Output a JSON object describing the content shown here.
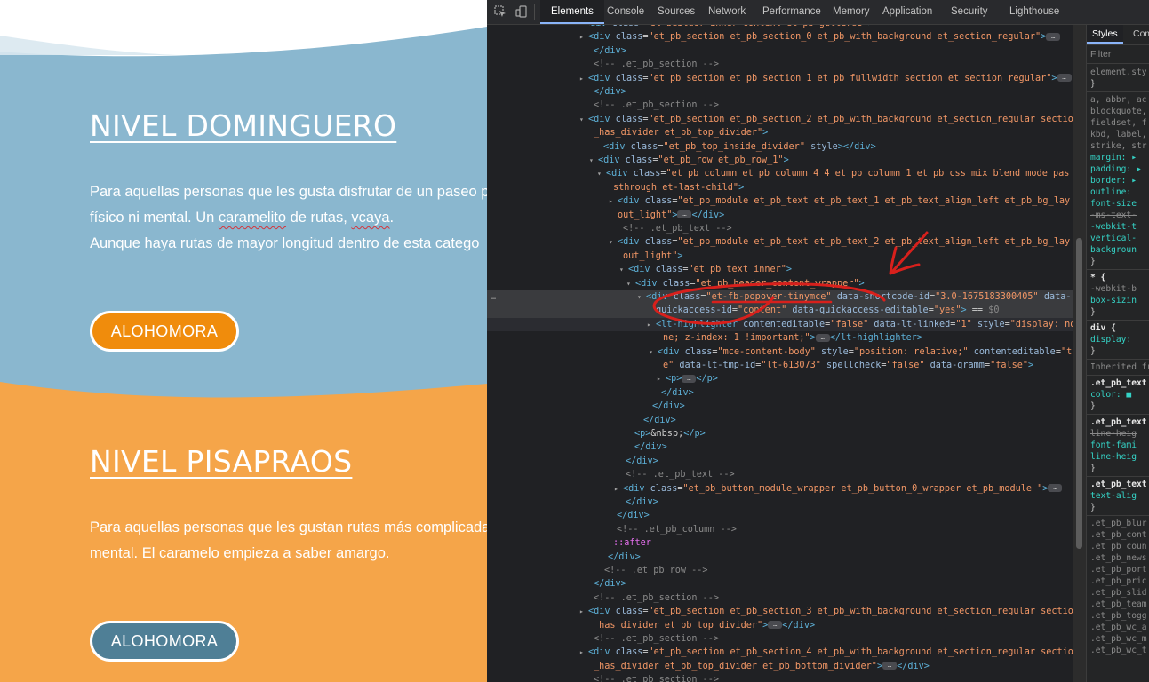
{
  "website": {
    "section1": {
      "title": "NIVEL DOMINGUERO",
      "para_line1": "Para aquellas personas que les gusta disfrutar de un paseo p",
      "para_line2_a": "físico ni mental. Un ",
      "para_line2_b": "caramelito",
      "para_line2_c": " de rutas, ",
      "para_line2_d": "vcaya",
      "para_line2_e": ".",
      "para_line3": "Aunque haya rutas de mayor longitud dentro de esta catego",
      "button": "ALOHOMORA",
      "bg_color": "#8ab7cf",
      "button_color": "#f08c0c"
    },
    "section2": {
      "title": "NIVEL PISAPRAOS",
      "para_line1": "Para aquellas personas que les gustan rutas más complicada",
      "para_line2": "mental. El caramelo empieza a saber amargo.",
      "button": "ALOHOMORA",
      "bg_color": "#f5a549",
      "button_color": "#4f7f96"
    }
  },
  "devtools": {
    "tabs": [
      "Elements",
      "Console",
      "Sources",
      "Network",
      "Performance",
      "Memory",
      "Application",
      "Security",
      "Lighthouse"
    ],
    "active_tab": "Elements",
    "dom_lines": [
      [
        [
          "tg",
          "<div "
        ],
        [
          "an",
          "class"
        ],
        [
          "tx",
          "="
        ],
        [
          "av",
          "\"et_builder_inner_content et_pb_gutters3\""
        ],
        [
          "tg",
          ">"
        ]
      ],
      [
        [
          "tg",
          "<div "
        ],
        [
          "an",
          "class"
        ],
        [
          "tx",
          "="
        ],
        [
          "av",
          "\"et_pb_section et_pb_section_0 et_pb_with_background et_section_regular\""
        ],
        [
          "tg",
          ">"
        ],
        [
          "el",
          "…"
        ]
      ],
      [
        [
          "tg",
          "</div>"
        ]
      ],
      [
        [
          "cm",
          "<!-- .et_pb_section -->"
        ]
      ],
      [
        [
          "tg",
          "<div "
        ],
        [
          "an",
          "class"
        ],
        [
          "tx",
          "="
        ],
        [
          "av",
          "\"et_pb_section et_pb_section_1 et_pb_fullwidth_section et_section_regular\""
        ],
        [
          "tg",
          ">"
        ],
        [
          "el",
          "…"
        ]
      ],
      [
        [
          "tg",
          "</div>"
        ]
      ],
      [
        [
          "cm",
          "<!-- .et_pb_section -->"
        ]
      ],
      [
        [
          "tg",
          "<div "
        ],
        [
          "an",
          "class"
        ],
        [
          "tx",
          "="
        ],
        [
          "av",
          "\"et_pb_section et_pb_section_2 et_pb_with_background et_section_regular section"
        ]
      ],
      [
        [
          "av",
          "_has_divider et_pb_top_divider\""
        ],
        [
          "tg",
          ">"
        ]
      ],
      [
        [
          "tg",
          "<div "
        ],
        [
          "an",
          "class"
        ],
        [
          "tx",
          "="
        ],
        [
          "av",
          "\"et_pb_top_inside_divider\""
        ],
        [
          "tx",
          " "
        ],
        [
          "an",
          "style"
        ],
        [
          "tg",
          "></div>"
        ]
      ],
      [
        [
          "tg",
          "<div "
        ],
        [
          "an",
          "class"
        ],
        [
          "tx",
          "="
        ],
        [
          "av",
          "\"et_pb_row et_pb_row_1\""
        ],
        [
          "tg",
          ">"
        ]
      ],
      [
        [
          "tg",
          "<div "
        ],
        [
          "an",
          "class"
        ],
        [
          "tx",
          "="
        ],
        [
          "av",
          "\"et_pb_column et_pb_column_4_4 et_pb_column_1  et_pb_css_mix_blend_mode_pas"
        ]
      ],
      [
        [
          "av",
          "sthrough et-last-child\""
        ],
        [
          "tg",
          ">"
        ]
      ],
      [
        [
          "tg",
          "<div "
        ],
        [
          "an",
          "class"
        ],
        [
          "tx",
          "="
        ],
        [
          "av",
          "\"et_pb_module et_pb_text et_pb_text_1  et_pb_text_align_left et_pb_bg_lay"
        ]
      ],
      [
        [
          "av",
          "out_light\""
        ],
        [
          "tg",
          ">"
        ],
        [
          "el",
          "…"
        ],
        [
          "tg",
          "</div>"
        ]
      ],
      [
        [
          "cm",
          "<!-- .et_pb_text -->"
        ]
      ],
      [
        [
          "tg",
          "<div "
        ],
        [
          "an",
          "class"
        ],
        [
          "tx",
          "="
        ],
        [
          "av",
          "\"et_pb_module et_pb_text et_pb_text_2  et_pb_text_align_left et_pb_bg_lay"
        ]
      ],
      [
        [
          "av",
          "out_light\""
        ],
        [
          "tg",
          ">"
        ]
      ],
      [
        [
          "tg",
          "<div "
        ],
        [
          "an",
          "class"
        ],
        [
          "tx",
          "="
        ],
        [
          "av",
          "\"et_pb_text_inner\""
        ],
        [
          "tg",
          ">"
        ]
      ],
      [
        [
          "tg",
          "<div "
        ],
        [
          "an",
          "class"
        ],
        [
          "tx",
          "="
        ],
        [
          "av",
          "\"et_pb_header_content_wrapper\""
        ],
        [
          "tg",
          ">"
        ]
      ],
      [
        [
          "tg",
          "<div "
        ],
        [
          "an",
          "class"
        ],
        [
          "tx",
          "="
        ],
        [
          "av",
          "\"et-fb-popover-tinymce\""
        ],
        [
          "tx",
          " "
        ],
        [
          "an",
          "data-shortcode-id"
        ],
        [
          "tx",
          "="
        ],
        [
          "av",
          "\"3.0-1675183300405\""
        ],
        [
          "tx",
          " "
        ],
        [
          "an",
          "data-"
        ]
      ],
      [
        [
          "an",
          "quickaccess-id"
        ],
        [
          "tx",
          "="
        ],
        [
          "av",
          "\"content\""
        ],
        [
          "tx",
          " "
        ],
        [
          "an",
          "data-quickaccess-editable"
        ],
        [
          "tx",
          "="
        ],
        [
          "av",
          "\"yes\""
        ],
        [
          "tg",
          ">"
        ],
        [
          "tx",
          " == "
        ],
        [
          "cm",
          "$0"
        ]
      ],
      [
        [
          "tg",
          "<lt-highlighter "
        ],
        [
          "an",
          "contenteditable"
        ],
        [
          "tx",
          "="
        ],
        [
          "av",
          "\"false\""
        ],
        [
          "tx",
          " "
        ],
        [
          "an",
          "data-lt-linked"
        ],
        [
          "tx",
          "="
        ],
        [
          "av",
          "\"1\""
        ],
        [
          "tx",
          " "
        ],
        [
          "an",
          "style"
        ],
        [
          "tx",
          "="
        ],
        [
          "av",
          "\"display: no"
        ]
      ],
      [
        [
          "av",
          "ne; z-index: 1 !important;\""
        ],
        [
          "tg",
          ">"
        ],
        [
          "el",
          "…"
        ],
        [
          "tg",
          "</lt-highlighter>"
        ]
      ],
      [
        [
          "tg",
          "<div "
        ],
        [
          "an",
          "class"
        ],
        [
          "tx",
          "="
        ],
        [
          "av",
          "\"mce-content-body\""
        ],
        [
          "tx",
          " "
        ],
        [
          "an",
          "style"
        ],
        [
          "tx",
          "="
        ],
        [
          "av",
          "\"position: relative;\""
        ],
        [
          "tx",
          " "
        ],
        [
          "an",
          "contenteditable"
        ],
        [
          "tx",
          "="
        ],
        [
          "av",
          "\"tru"
        ]
      ],
      [
        [
          "av",
          "e\""
        ],
        [
          "tx",
          " "
        ],
        [
          "an",
          "data-lt-tmp-id"
        ],
        [
          "tx",
          "="
        ],
        [
          "av",
          "\"lt-613073\""
        ],
        [
          "tx",
          " "
        ],
        [
          "an",
          "spellcheck"
        ],
        [
          "tx",
          "="
        ],
        [
          "av",
          "\"false\""
        ],
        [
          "tx",
          " "
        ],
        [
          "an",
          "data-gramm"
        ],
        [
          "tx",
          "="
        ],
        [
          "av",
          "\"false\""
        ],
        [
          "tg",
          ">"
        ]
      ],
      [
        [
          "tg",
          "<p>"
        ],
        [
          "el",
          "…"
        ],
        [
          "tg",
          "</p>"
        ]
      ],
      [
        [
          "tg",
          "</div>"
        ]
      ],
      [
        [
          "tg",
          "</div>"
        ]
      ],
      [
        [
          "tg",
          "</div>"
        ]
      ],
      [
        [
          "tg",
          "<p>"
        ],
        [
          "tx",
          "&nbsp;"
        ],
        [
          "tg",
          "</p>"
        ]
      ],
      [
        [
          "tg",
          "</div>"
        ]
      ],
      [
        [
          "tg",
          "</div>"
        ]
      ],
      [
        [
          "cm",
          "<!-- .et_pb_text -->"
        ]
      ],
      [
        [
          "tg",
          "<div "
        ],
        [
          "an",
          "class"
        ],
        [
          "tx",
          "="
        ],
        [
          "av",
          "\"et_pb_button_module_wrapper et_pb_button_0_wrapper  et_pb_module \""
        ],
        [
          "tg",
          ">"
        ],
        [
          "el",
          "…"
        ]
      ],
      [
        [
          "tg",
          "</div>"
        ]
      ],
      [
        [
          "tg",
          "</div>"
        ]
      ],
      [
        [
          "cm",
          "<!-- .et_pb_column -->"
        ]
      ],
      [
        [
          "ps",
          "::after"
        ]
      ],
      [
        [
          "tg",
          "</div>"
        ]
      ],
      [
        [
          "cm",
          "<!-- .et_pb_row -->"
        ]
      ],
      [
        [
          "tg",
          "</div>"
        ]
      ],
      [
        [
          "cm",
          "<!-- .et_pb_section -->"
        ]
      ],
      [
        [
          "tg",
          "<div "
        ],
        [
          "an",
          "class"
        ],
        [
          "tx",
          "="
        ],
        [
          "av",
          "\"et_pb_section et_pb_section_3 et_pb_with_background et_section_regular section"
        ]
      ],
      [
        [
          "av",
          "_has_divider et_pb_top_divider\""
        ],
        [
          "tg",
          ">"
        ],
        [
          "el",
          "…"
        ],
        [
          "tg",
          "</div>"
        ]
      ],
      [
        [
          "cm",
          "<!-- .et_pb_section -->"
        ]
      ],
      [
        [
          "tg",
          "<div "
        ],
        [
          "an",
          "class"
        ],
        [
          "tx",
          "="
        ],
        [
          "av",
          "\"et_pb_section et_pb_section_4 et_pb_with_background et_section_regular section"
        ]
      ],
      [
        [
          "av",
          "_has_divider et_pb_top_divider et_pb_bottom_divider\""
        ],
        [
          "tg",
          ">"
        ],
        [
          "el",
          "…"
        ],
        [
          "tg",
          "</div>"
        ]
      ],
      [
        [
          "cm",
          "<!-- .et_pb_section -->"
        ]
      ]
    ],
    "dom_gutter_dots": "…",
    "styles": {
      "tabs": [
        "Styles",
        "Com"
      ],
      "filter_placeholder": "Filter",
      "lines": [
        [
          "st-gray",
          "element.sty"
        ],
        [
          "tx",
          "}"
        ],
        [
          "st-gray",
          "a, abbr, ac"
        ],
        [
          "st-gray",
          "blockquote,"
        ],
        [
          "st-gray",
          "fieldset, f"
        ],
        [
          "st-gray",
          "kbd, label,"
        ],
        [
          "st-gray",
          "strike, str"
        ],
        [
          "st-prop",
          "  margin: ▸"
        ],
        [
          "st-prop",
          "  padding: ▸"
        ],
        [
          "st-prop",
          "  border: ▸"
        ],
        [
          "st-prop",
          "  outline: "
        ],
        [
          "st-prop",
          "  font-size"
        ],
        [
          "strike",
          "  -ms-text-"
        ],
        [
          "st-prop",
          "  -webkit-t"
        ],
        [
          "st-prop",
          "  vertical-"
        ],
        [
          "st-prop",
          "  backgroun"
        ],
        [
          "tx",
          "}"
        ],
        [
          "st-sel",
          "* {"
        ],
        [
          "strike",
          "  -webkit-b"
        ],
        [
          "st-prop",
          "  box-sizin"
        ],
        [
          "tx",
          "}"
        ],
        [
          "st-sel",
          "div {"
        ],
        [
          "st-prop",
          "  display: "
        ],
        [
          "tx",
          "}"
        ],
        [
          "st-gray",
          "Inherited from"
        ],
        [
          "st-sel",
          ".et_pb_text"
        ],
        [
          "st-prop",
          "  color: ■"
        ],
        [
          "tx",
          "}"
        ],
        [
          "st-sel",
          ".et_pb_text"
        ],
        [
          "strike",
          "  line-heig"
        ],
        [
          "st-prop",
          "  font-fami"
        ],
        [
          "st-prop",
          "  line-heig"
        ],
        [
          "tx",
          "}"
        ],
        [
          "st-sel",
          ".et_pb_text"
        ],
        [
          "st-prop",
          "  text-alig"
        ],
        [
          "tx",
          "}"
        ],
        [
          "st-gray",
          ".et_pb_blur"
        ],
        [
          "st-gray",
          ".et_pb_cont"
        ],
        [
          "st-gray",
          ".et_pb_coun"
        ],
        [
          "st-gray",
          ".et_pb_news"
        ],
        [
          "st-gray",
          ".et_pb_port"
        ],
        [
          "st-gray",
          ".et_pb_pric"
        ],
        [
          "st-gray",
          ".et_pb_slid"
        ],
        [
          "st-gray",
          ".et_pb_team"
        ],
        [
          "st-gray",
          ".et_pb_togg"
        ],
        [
          "st-gray",
          ".et_pb_wc_a"
        ],
        [
          "st-gray",
          ".et_pb_wc_m"
        ],
        [
          "st-gray",
          ".et_pb_wc_t"
        ]
      ]
    }
  },
  "annotation_color": "#d8201c",
  "icons": [
    "inspect-element-icon",
    "device-toolbar-icon",
    "red-arrow-annotation",
    "red-circle-annotation"
  ]
}
